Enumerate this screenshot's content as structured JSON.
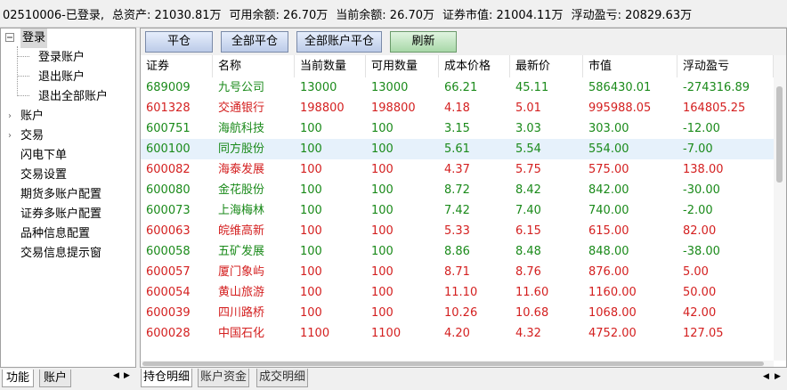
{
  "status": {
    "account_status": "02510006-已登录,",
    "total_assets": "总资产: 21030.81万",
    "available": "可用余额: 26.70万",
    "current_balance": "当前余额: 26.70万",
    "market_value": "证券市值: 21004.11万",
    "floating_pnl": "浮动盈亏: 20829.63万"
  },
  "tree": {
    "root": "登录",
    "children": [
      "登录账户",
      "退出账户",
      "退出全部账户"
    ],
    "items": [
      "账户",
      "交易",
      "闪电下单",
      "交易设置",
      "期货多账户配置",
      "证券多账户配置",
      "品种信息配置",
      "交易信息提示窗"
    ]
  },
  "left_tabs": [
    "功能",
    "账户"
  ],
  "toolbar": {
    "close": "平仓",
    "close_all": "全部平仓",
    "close_all_accounts": "全部账户平仓",
    "refresh": "刷新"
  },
  "columns": [
    "证券",
    "名称",
    "当前数量",
    "可用数量",
    "成本价格",
    "最新价",
    "市值",
    "浮动盈亏"
  ],
  "rows": [
    {
      "code": "689009",
      "name": "九号公司",
      "qty": "13000",
      "avail": "13000",
      "cost": "66.21",
      "price": "45.11",
      "mv": "586430.01",
      "pnl": "-274316.89",
      "color": "green"
    },
    {
      "code": "601328",
      "name": "交通银行",
      "qty": "198800",
      "avail": "198800",
      "cost": "4.18",
      "price": "5.01",
      "mv": "995988.05",
      "pnl": "164805.25",
      "color": "red"
    },
    {
      "code": "600751",
      "name": "海航科技",
      "qty": "100",
      "avail": "100",
      "cost": "3.15",
      "price": "3.03",
      "mv": "303.00",
      "pnl": "-12.00",
      "color": "green"
    },
    {
      "code": "600100",
      "name": "同方股份",
      "qty": "100",
      "avail": "100",
      "cost": "5.61",
      "price": "5.54",
      "mv": "554.00",
      "pnl": "-7.00",
      "color": "green"
    },
    {
      "code": "600082",
      "name": "海泰发展",
      "qty": "100",
      "avail": "100",
      "cost": "4.37",
      "price": "5.75",
      "mv": "575.00",
      "pnl": "138.00",
      "color": "red"
    },
    {
      "code": "600080",
      "name": "金花股份",
      "qty": "100",
      "avail": "100",
      "cost": "8.72",
      "price": "8.42",
      "mv": "842.00",
      "pnl": "-30.00",
      "color": "green"
    },
    {
      "code": "600073",
      "name": "上海梅林",
      "qty": "100",
      "avail": "100",
      "cost": "7.42",
      "price": "7.40",
      "mv": "740.00",
      "pnl": "-2.00",
      "color": "green"
    },
    {
      "code": "600063",
      "name": "皖维高新",
      "qty": "100",
      "avail": "100",
      "cost": "5.33",
      "price": "6.15",
      "mv": "615.00",
      "pnl": "82.00",
      "color": "red"
    },
    {
      "code": "600058",
      "name": "五矿发展",
      "qty": "100",
      "avail": "100",
      "cost": "8.86",
      "price": "8.48",
      "mv": "848.00",
      "pnl": "-38.00",
      "color": "green"
    },
    {
      "code": "600057",
      "name": "厦门象屿",
      "qty": "100",
      "avail": "100",
      "cost": "8.71",
      "price": "8.76",
      "mv": "876.00",
      "pnl": "5.00",
      "color": "red"
    },
    {
      "code": "600054",
      "name": "黄山旅游",
      "qty": "100",
      "avail": "100",
      "cost": "11.10",
      "price": "11.60",
      "mv": "1160.00",
      "pnl": "50.00",
      "color": "red"
    },
    {
      "code": "600039",
      "name": "四川路桥",
      "qty": "100",
      "avail": "100",
      "cost": "10.26",
      "price": "10.68",
      "mv": "1068.00",
      "pnl": "42.00",
      "color": "red"
    },
    {
      "code": "600028",
      "name": "中国石化",
      "qty": "1100",
      "avail": "1100",
      "cost": "4.20",
      "price": "4.32",
      "mv": "4752.00",
      "pnl": "127.05",
      "color": "red"
    }
  ],
  "highlight_row": 3,
  "bottom_tabs": [
    "持仓明细",
    "账户资金",
    "成交明细"
  ],
  "icons": {
    "expanded": "minus-box-icon",
    "collapsed": "chevron-right-icon",
    "scroll_left": "triangle-left-icon",
    "scroll_right": "triangle-right-icon"
  },
  "colors": {
    "profit": "#d42020",
    "loss": "#1a8a1a",
    "highlight": "#e6f1fb"
  }
}
